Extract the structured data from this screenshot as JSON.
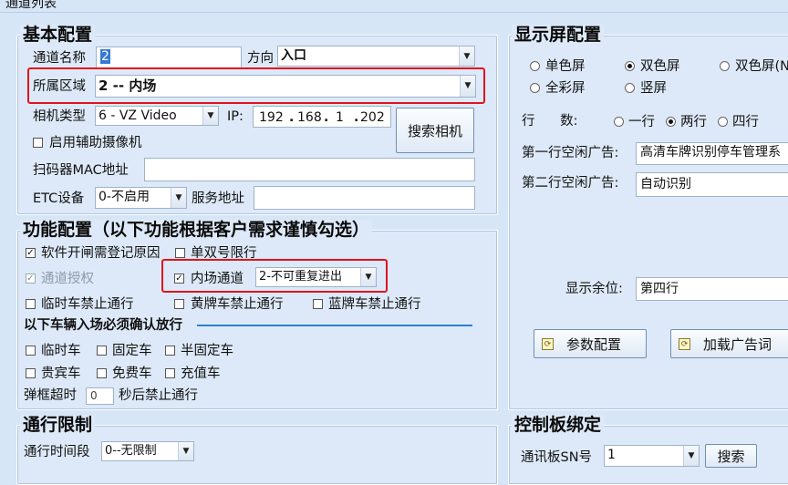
{
  "window": {
    "title": "通道列表"
  },
  "basic": {
    "title": "基本配置",
    "channel_name_label": "通道名称",
    "channel_name_value": "2",
    "direction_label": "方向",
    "direction_value": "入口",
    "area_label": "所属区域",
    "area_value": "2 -- 内场",
    "camera_type_label": "相机类型",
    "camera_type_value": "6 - VZ Video",
    "ip_label": "IP:",
    "ip": [
      "192",
      "168",
      "1",
      "202"
    ],
    "search_camera_button": "搜索相机",
    "aux_camera_label": "启用辅助摄像机",
    "scanner_mac_label": "扫码器MAC地址",
    "scanner_mac_value": "",
    "etc_label": "ETC设备",
    "etc_value": "0-不启用",
    "service_addr_label": "服务地址",
    "service_addr_value": ""
  },
  "function": {
    "title": "功能配置（以下功能根据客户需求谨慎勾选）",
    "software_open_label": "软件开闸需登记原因",
    "odd_even_label": "单双号限行",
    "channel_auth_label": "通道授权",
    "inner_channel_label": "内场通道",
    "inner_channel_value": "2-不可重复进出",
    "temp_forbid_label": "临时车禁止通行",
    "yellow_forbid_label": "黄牌车禁止通行",
    "blue_forbid_label": "蓝牌车禁止通行",
    "confirm_heading": "以下车辆入场必须确认放行",
    "temp_car": "临时车",
    "fixed_car": "固定车",
    "semi_fixed_car": "半固定车",
    "vip_car": "贵宾车",
    "free_car": "免费车",
    "stored_car": "充值车",
    "popup_timeout_label": "弹框超时",
    "popup_timeout_value": "0",
    "popup_timeout_suffix": "秒后禁止通行"
  },
  "limit": {
    "title": "通行限制",
    "period_label": "通行时间段",
    "period_value": "0--无限制"
  },
  "display": {
    "title": "显示屏配置",
    "mono": "单色屏",
    "dual": "双色屏",
    "dual_n": "双色屏(N",
    "full_color": "全彩屏",
    "vertical": "竖屏",
    "rows_label": "行      数:",
    "one_row": "一行",
    "two_rows": "两行",
    "four_rows": "四行",
    "row1_ad_label": "第一行空闲广告:",
    "row1_ad_value": "高清车牌识别停车管理系",
    "row2_ad_label": "第二行空闲广告:",
    "row2_ad_value": "自动识别",
    "remaining_label": "显示余位:",
    "remaining_value": "第四行",
    "param_button": "参数配置",
    "load_ad_button": "加载广告词"
  },
  "control": {
    "title": "控制板绑定",
    "sn_label": "通讯板SN号",
    "sn_value": "1",
    "search_button": "搜索"
  }
}
